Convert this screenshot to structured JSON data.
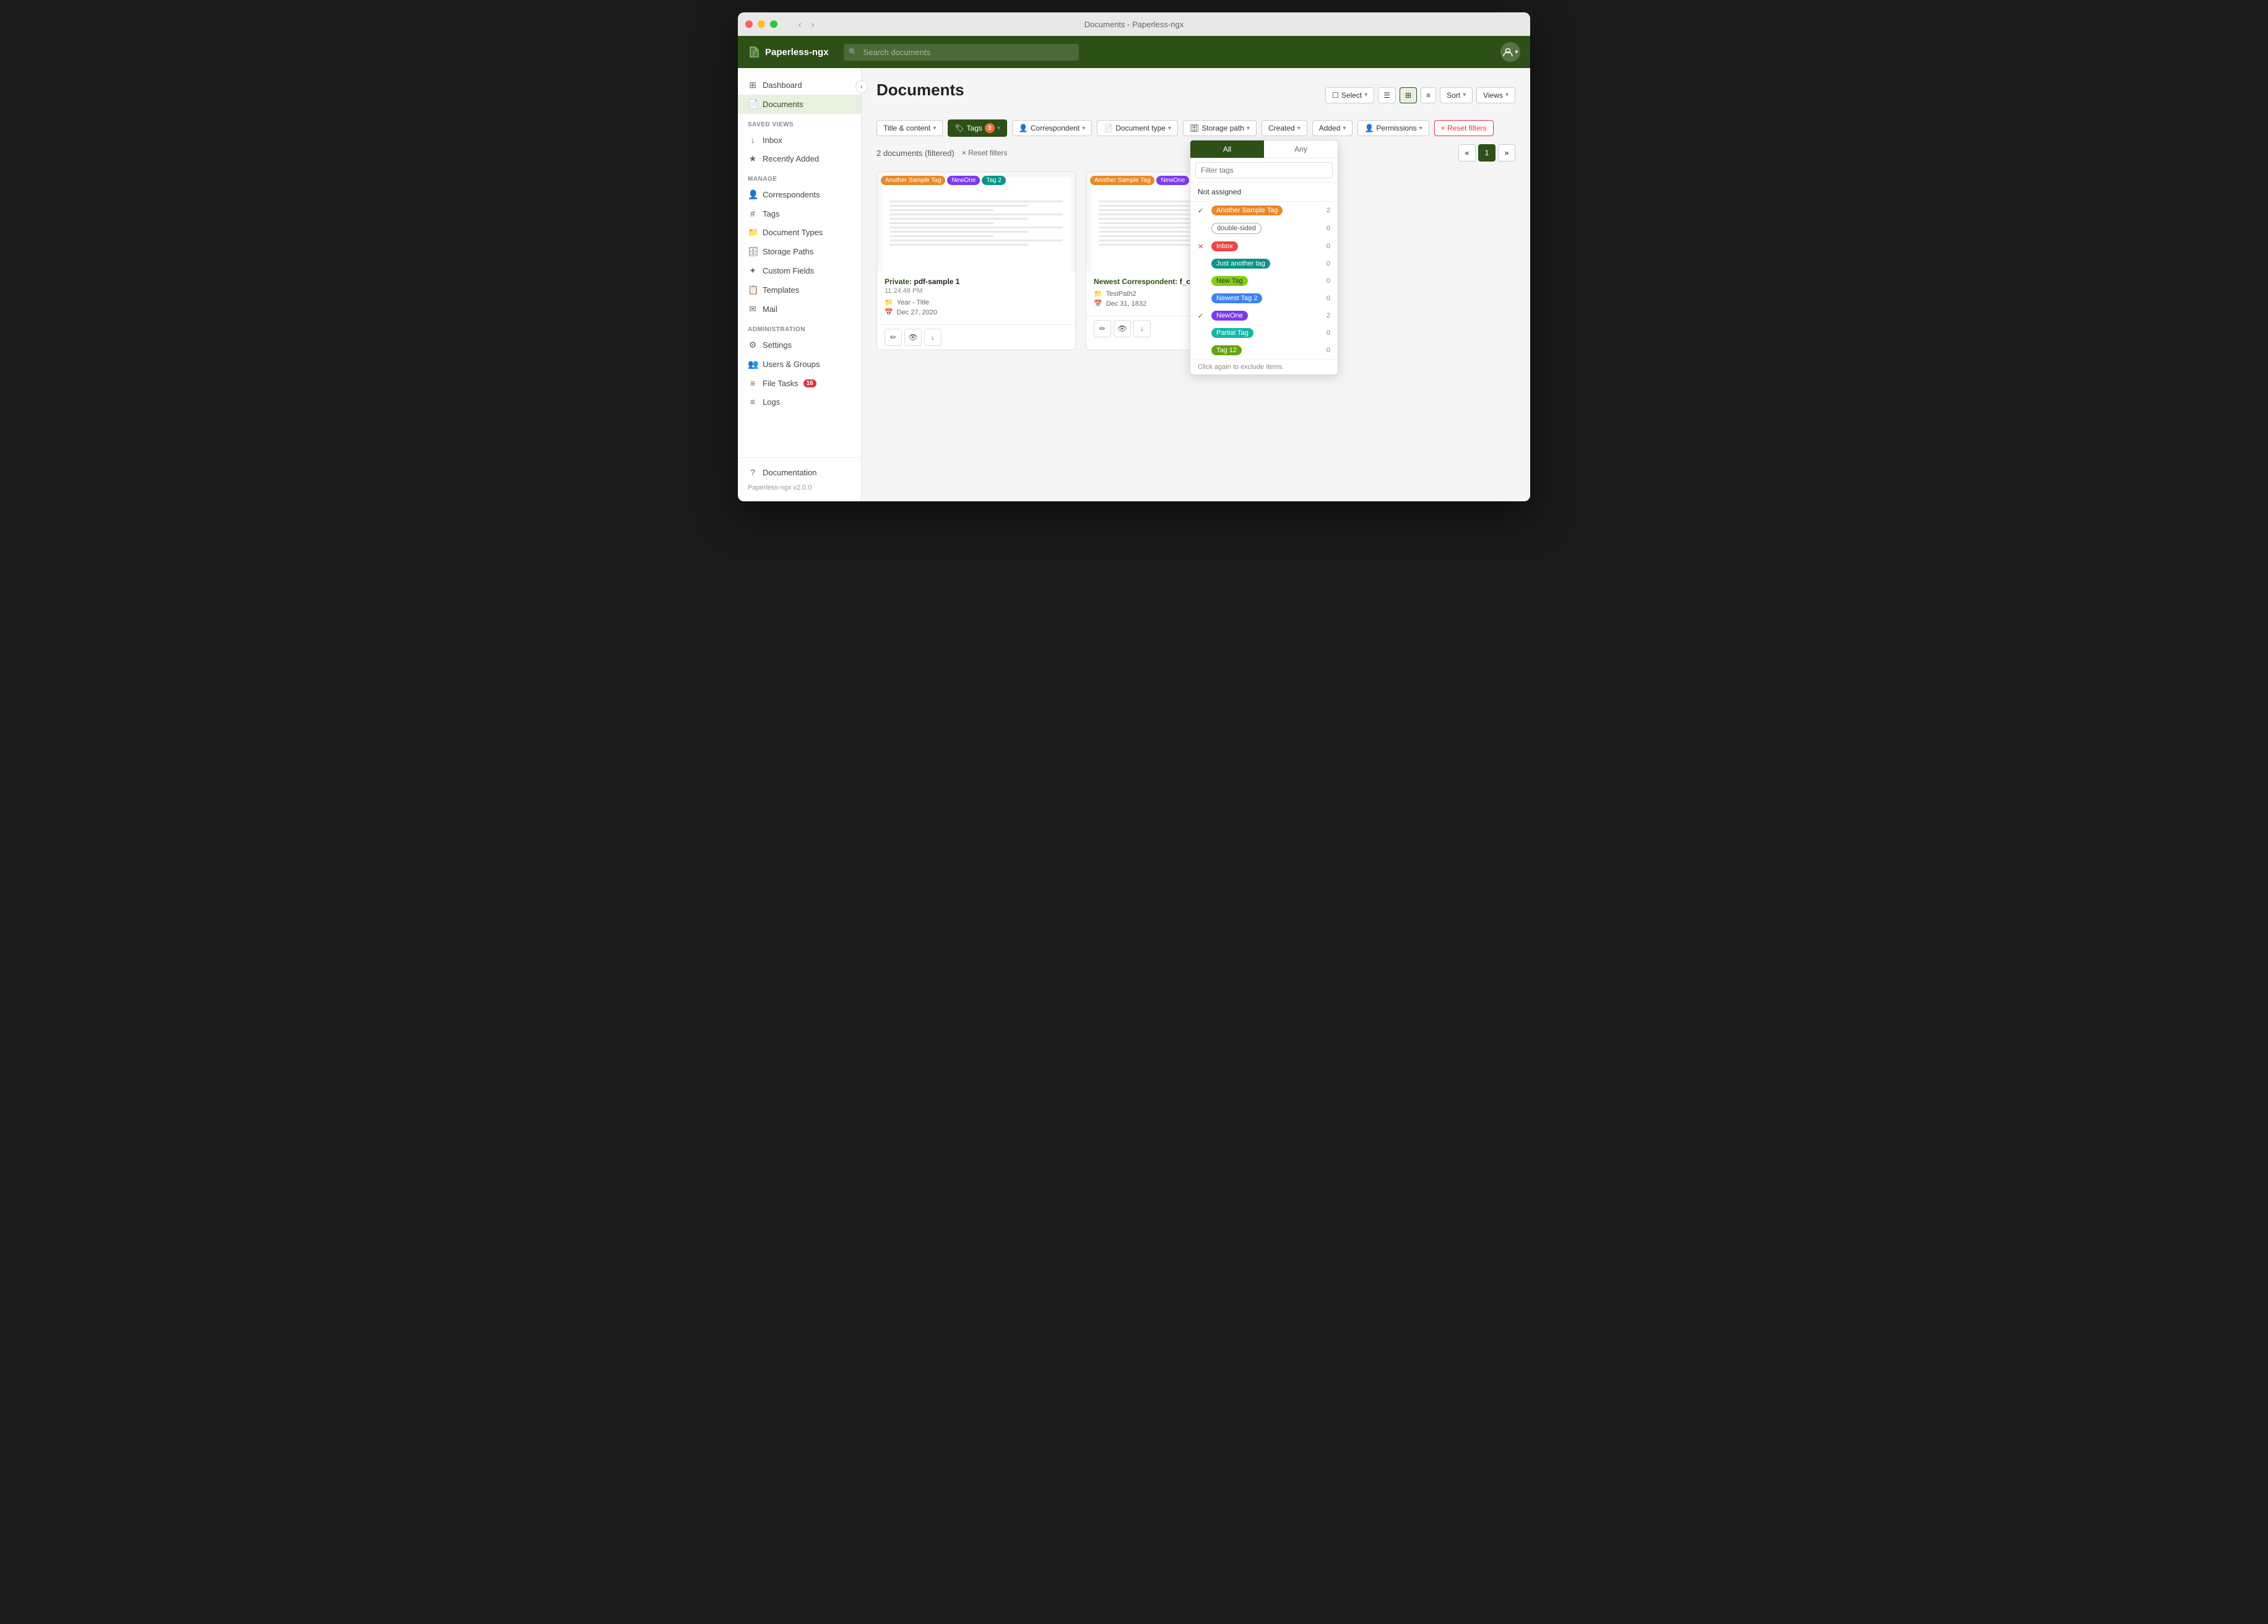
{
  "window": {
    "title": "Documents - Paperless-ngx"
  },
  "app": {
    "name": "Paperless-ngx"
  },
  "navbar": {
    "search_placeholder": "Search documents",
    "brand": "Paperless-ngx"
  },
  "sidebar": {
    "saved_views_label": "SAVED VIEWS",
    "manage_label": "MANAGE",
    "admin_label": "ADMINISTRATION",
    "items_top": [
      {
        "id": "dashboard",
        "label": "Dashboard",
        "icon": "⊞"
      },
      {
        "id": "documents",
        "label": "Documents",
        "icon": "📄",
        "active": true
      }
    ],
    "saved_views": [
      {
        "id": "inbox",
        "label": "Inbox",
        "icon": "↓"
      },
      {
        "id": "recently-added",
        "label": "Recently Added",
        "icon": "★"
      }
    ],
    "manage": [
      {
        "id": "correspondents",
        "label": "Correspondents",
        "icon": "👤"
      },
      {
        "id": "tags",
        "label": "Tags",
        "icon": "#"
      },
      {
        "id": "document-types",
        "label": "Document Types",
        "icon": "📁"
      },
      {
        "id": "storage-paths",
        "label": "Storage Paths",
        "icon": "🗄"
      },
      {
        "id": "custom-fields",
        "label": "Custom Fields",
        "icon": "✦"
      },
      {
        "id": "templates",
        "label": "Templates",
        "icon": "📋"
      },
      {
        "id": "mail",
        "label": "Mail",
        "icon": "✉"
      }
    ],
    "admin": [
      {
        "id": "settings",
        "label": "Settings",
        "icon": "⚙"
      },
      {
        "id": "users-groups",
        "label": "Users & Groups",
        "icon": "👥"
      },
      {
        "id": "file-tasks",
        "label": "File Tasks",
        "icon": "≡",
        "badge": "16"
      },
      {
        "id": "logs",
        "label": "Logs",
        "icon": "≡"
      }
    ],
    "doc_link": "Documentation",
    "version": "Paperless-ngx v2.0.0"
  },
  "page": {
    "title": "Documents"
  },
  "toolbar": {
    "filter_label": "Title & content",
    "tags_label": "Tags",
    "tags_count": "3",
    "correspondent_label": "Correspondent",
    "document_type_label": "Document type",
    "storage_path_label": "Storage path",
    "created_label": "Created",
    "added_label": "Added",
    "permissions_label": "Permissions",
    "reset_filters_label": "× Reset filters",
    "select_label": "Select",
    "sort_label": "Sort",
    "views_label": "Views"
  },
  "results": {
    "count_text": "2 documents (filtered)",
    "reset_label": "× Reset filters"
  },
  "documents": [
    {
      "id": 1,
      "tags": [
        "Another Sample Tag",
        "NewOne",
        "Tag 2"
      ],
      "tag_colors": [
        "orange",
        "purple",
        "teal"
      ],
      "title_prefix": "Private",
      "title_main": "pdf-sample 1",
      "subtitle": "11.24.48 PM",
      "meta1_icon": "📁",
      "meta1": "Year - Title",
      "meta2_icon": "📅",
      "meta2": "Dec 27, 2020"
    },
    {
      "id": 2,
      "tags": [
        "Another Sample Tag",
        "NewOne"
      ],
      "tag_colors": [
        "orange",
        "purple"
      ],
      "title_prefix": "Newest Correspondent",
      "title_main": "f_combineds",
      "subtitle": "",
      "meta1_icon": "📁",
      "meta1": "TestPath2",
      "meta2_icon": "📅",
      "meta2": "Dec 31, 1832"
    }
  ],
  "pagination": {
    "prev": "«",
    "current": "1",
    "next": "»"
  },
  "tags_dropdown": {
    "tab_all": "All",
    "tab_any": "Any",
    "search_placeholder": "Filter tags",
    "not_assigned": "Not assigned",
    "footer_hint": "Click again to exclude items.",
    "tags": [
      {
        "id": "another-sample-tag",
        "label": "Another Sample Tag",
        "color": "orange",
        "count": "2",
        "state": "checked"
      },
      {
        "id": "double-sided",
        "label": "double-sided",
        "color": "outline",
        "count": "0",
        "state": "none"
      },
      {
        "id": "inbox",
        "label": "Inbox",
        "color": "red",
        "count": "0",
        "state": "excluded"
      },
      {
        "id": "just-another-tag",
        "label": "Just another tag",
        "color": "teal",
        "count": "0",
        "state": "none"
      },
      {
        "id": "new-tag",
        "label": "New Tag",
        "color": "green-light",
        "count": "0",
        "state": "none"
      },
      {
        "id": "newest-tag-2",
        "label": "Newest Tag 2",
        "color": "blue",
        "count": "0",
        "state": "none"
      },
      {
        "id": "newone",
        "label": "NewOne",
        "color": "purple",
        "count": "2",
        "state": "checked"
      },
      {
        "id": "partial-tag",
        "label": "Partial Tag",
        "color": "teal2",
        "count": "0",
        "state": "none"
      },
      {
        "id": "tag-12",
        "label": "Tag 12",
        "color": "yellow-green",
        "count": "0",
        "state": "none"
      }
    ]
  }
}
